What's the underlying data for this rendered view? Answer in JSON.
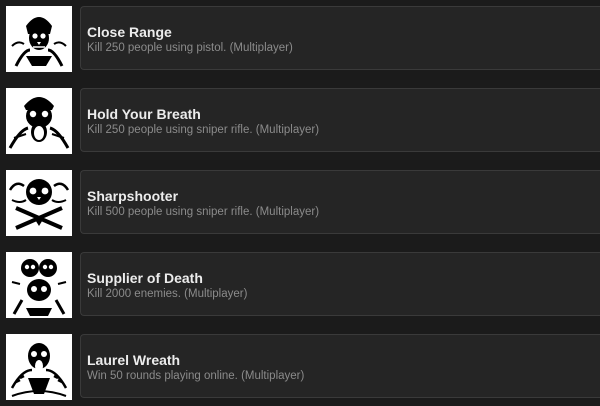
{
  "achievements": [
    {
      "title": "Close Range",
      "description": "Kill 250 people using pistol. (Multiplayer)",
      "icon": "hooded-skull-icon"
    },
    {
      "title": "Hold Your Breath",
      "description": "Kill 250 people using sniper rifle. (Multiplayer)",
      "icon": "screaming-skull-icon"
    },
    {
      "title": "Sharpshooter",
      "description": "Kill 500 people using sniper rifle. (Multiplayer)",
      "icon": "skull-crossbones-icon"
    },
    {
      "title": "Supplier of Death",
      "description": "Kill 2000 enemies. (Multiplayer)",
      "icon": "skull-pile-icon"
    },
    {
      "title": "Laurel Wreath",
      "description": "Win 50 rounds playing online. (Multiplayer)",
      "icon": "laurel-skull-icon"
    }
  ],
  "colors": {
    "page_background": "#1b1b1b",
    "panel_background": "#252525",
    "title_text": "#ececec",
    "description_text": "#8b8b8b"
  }
}
